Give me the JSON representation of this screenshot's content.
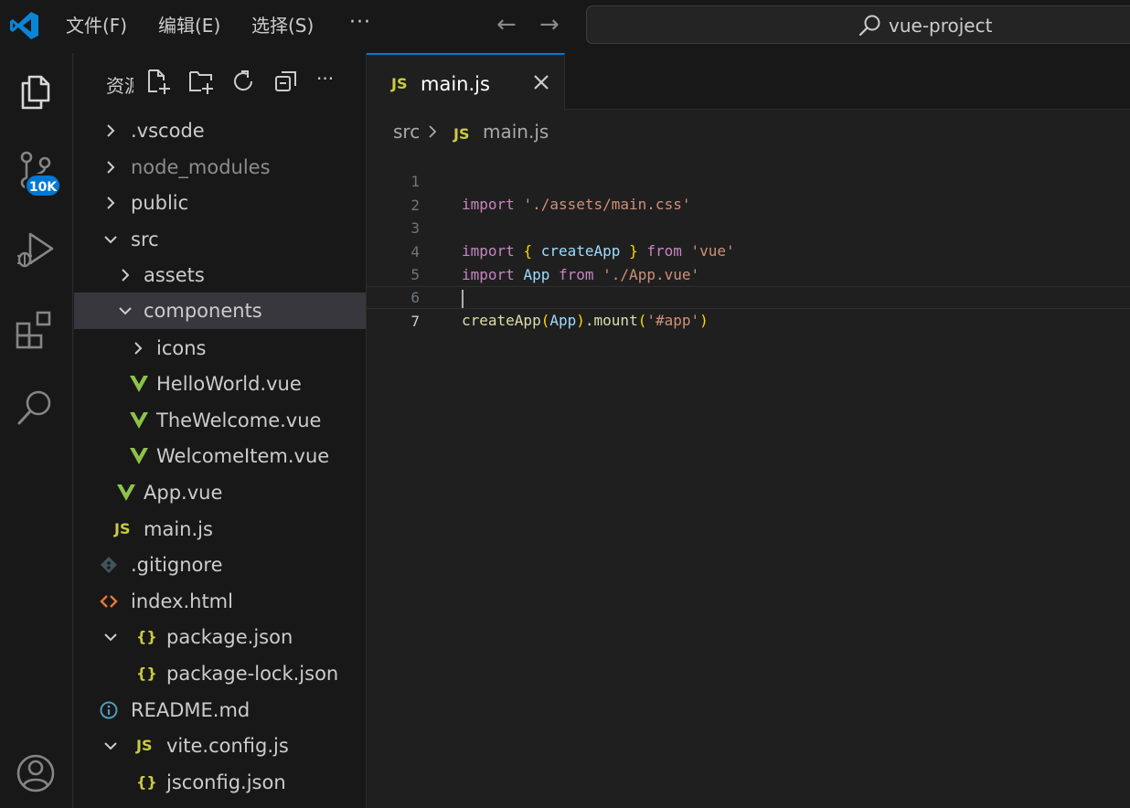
{
  "titlebar": {
    "menu": [
      "文件(F)",
      "编辑(E)",
      "选择(S)"
    ],
    "more": "···",
    "back_arrow": "←",
    "forward_arrow": "→",
    "search_text": "vue-project"
  },
  "activitybar": {
    "icons": [
      "explorer-icon",
      "source-control-icon",
      "run-debug-icon",
      "extensions-icon",
      "search-icon",
      "account-icon"
    ],
    "source_control_badge": "10K"
  },
  "sidebar": {
    "title": "资源管理器",
    "actions": [
      "new-file-icon",
      "new-folder-icon",
      "refresh-icon",
      "collapse-all-icon"
    ],
    "more": "···",
    "tree": [
      {
        "label": ".vscode",
        "kind": "folder",
        "expanded": false
      },
      {
        "label": "node_modules",
        "kind": "folder",
        "expanded": false,
        "dimmed": true
      },
      {
        "label": "public",
        "kind": "folder",
        "expanded": false
      },
      {
        "label": "src",
        "kind": "folder",
        "expanded": true
      },
      {
        "label": "assets",
        "kind": "folder",
        "expanded": false
      },
      {
        "label": "components",
        "kind": "folder",
        "expanded": true,
        "selected": true
      },
      {
        "label": "icons",
        "kind": "folder",
        "expanded": false
      },
      {
        "label": "HelloWorld.vue",
        "kind": "vue"
      },
      {
        "label": "TheWelcome.vue",
        "kind": "vue"
      },
      {
        "label": "WelcomeItem.vue",
        "kind": "vue"
      },
      {
        "label": "App.vue",
        "kind": "vue"
      },
      {
        "label": "main.js",
        "kind": "js"
      },
      {
        "label": ".gitignore",
        "kind": "git"
      },
      {
        "label": "index.html",
        "kind": "html"
      },
      {
        "label": "package.json",
        "kind": "json",
        "expanded": true
      },
      {
        "label": "package-lock.json",
        "kind": "json"
      },
      {
        "label": "README.md",
        "kind": "info"
      },
      {
        "label": "vite.config.js",
        "kind": "js",
        "expanded": true
      },
      {
        "label": "jsconfig.json",
        "kind": "json"
      }
    ]
  },
  "editor": {
    "tab": {
      "icon": "JS",
      "label": "main.js",
      "close": "×"
    },
    "breadcrumb": {
      "folder": "src",
      "file_icon": "JS",
      "file": "main.js"
    },
    "line_numbers": [
      "1",
      "2",
      "3",
      "4",
      "5",
      "6",
      "7"
    ],
    "active_line": "7",
    "code": {
      "l1_kw": "import",
      "l1_str": "'./assets/main.css'",
      "l3_kw": "import",
      "l3_open": "{",
      "l3_name": "createApp",
      "l3_close": "}",
      "l3_from": "from",
      "l3_str": "'vue'",
      "l4_kw": "import",
      "l4_name": "App",
      "l4_from": "from",
      "l4_str": "'./App.vue'",
      "l6_fn": "createApp",
      "l6_open": "(",
      "l6_arg": "App",
      "l6_close": ")",
      "l6_dot": ".",
      "l6_method": "mount",
      "l6_open2": "(",
      "l6_str": "'#app'",
      "l6_close2": ")"
    }
  },
  "colors": {
    "accent": "#0078d4",
    "vue_green": "#8dc149",
    "js_yellow": "#cbcb41",
    "html_orange": "#e37933",
    "info_blue": "#519aba",
    "git_gray": "#41535b"
  }
}
